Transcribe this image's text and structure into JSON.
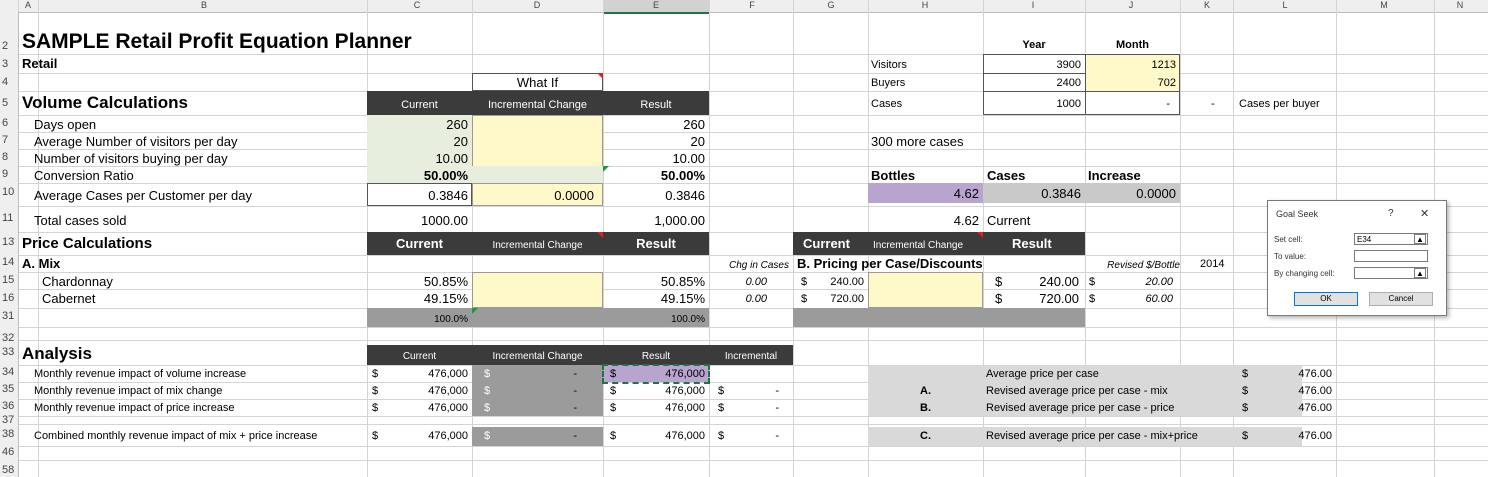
{
  "col_headers": [
    "A",
    "B",
    "C",
    "D",
    "E",
    "F",
    "G",
    "H",
    "I",
    "J",
    "K",
    "L",
    "M",
    "N"
  ],
  "row_numbers": [
    "2",
    "3",
    "4",
    "5",
    "6",
    "7",
    "8",
    "9",
    "10",
    "11",
    "13",
    "14",
    "15",
    "16",
    "31",
    "32",
    "33",
    "34",
    "35",
    "36",
    "37",
    "38",
    "46",
    "58"
  ],
  "title": "SAMPLE Retail Profit Equation Planner",
  "subtitle": "Retail",
  "what_if": "What If",
  "volume": {
    "heading": "Volume Calculations",
    "hdr_current": "Current",
    "hdr_incr": "Incremental Change",
    "hdr_result": "Result",
    "rows": [
      {
        "label": "Days open",
        "current": "260",
        "incr": "",
        "result": "260"
      },
      {
        "label": "Average Number of visitors per day",
        "current": "20",
        "incr": "",
        "result": "20"
      },
      {
        "label": "Number of visitors buying per day",
        "current": "10.00",
        "incr": "",
        "result": "10.00"
      },
      {
        "label": "Conversion Ratio",
        "current": "50.00%",
        "incr": "",
        "result": "50.00%"
      },
      {
        "label": "Average Cases per Customer per day",
        "current": "0.3846",
        "incr": "0.0000",
        "result": "0.3846"
      }
    ],
    "total_label": "Total cases sold",
    "total_current": "1000.00",
    "total_result": "1,000.00"
  },
  "price": {
    "heading": "Price Calculations",
    "hdr_current": "Current",
    "hdr_incr": "Incremental Change",
    "hdr_result": "Result",
    "mix_label": "A. Mix",
    "chg_in_cases": "Chg in Cases",
    "rows": [
      {
        "label": "Chardonnay",
        "current": "50.85%",
        "result": "50.85%",
        "chg": "0.00"
      },
      {
        "label": "Cabernet",
        "current": "49.15%",
        "result": "49.15%",
        "chg": "0.00"
      }
    ],
    "total_current": "100.0%",
    "total_result": "100.0%"
  },
  "pricing_case": {
    "hdr_current": "Current",
    "hdr_incr": "Incremental Change",
    "hdr_result": "Result",
    "title": "B. Pricing per Case/Discounts",
    "revised_hdr": "Revised $/Bottle",
    "year": "2014",
    "rows": [
      {
        "cur_sym": "$",
        "cur": "240.00",
        "res_sym": "$",
        "res": "240.00",
        "rev_sym": "$",
        "rev": "20.00"
      },
      {
        "cur_sym": "$",
        "cur": "720.00",
        "res_sym": "$",
        "res": "720.00",
        "rev_sym": "$",
        "rev": "60.00"
      }
    ]
  },
  "top_right": {
    "year_hdr": "Year",
    "month_hdr": "Month",
    "rows": [
      {
        "label": "Visitors",
        "year": "3900",
        "month": "1213"
      },
      {
        "label": "Buyers",
        "year": "2400",
        "month": "702"
      },
      {
        "label": "Cases",
        "year": "1000",
        "month": "-"
      }
    ],
    "dash": "-",
    "cases_per_buyer": "Cases per buyer",
    "more_cases": "300 more cases",
    "bottles_hdr": "Bottles",
    "cases_hdr": "Cases",
    "increase_hdr": "Increase",
    "bottles_val": "4.62",
    "cases_val": "0.3846",
    "increase_val": "0.0000",
    "bottles_current": "4.62",
    "current_label": "Current"
  },
  "analysis": {
    "heading": "Analysis",
    "hdr_current": "Current",
    "hdr_incr": "Incremental Change",
    "hdr_result": "Result",
    "hdr_incremental": "Incremental",
    "rows": [
      {
        "label": "Monthly revenue impact of volume increase",
        "cur_sym": "$",
        "cur": "476,000",
        "inc_sym": "$",
        "inc": "-",
        "res_sym": "$",
        "res": "476,000",
        "i_sym": "",
        "i": ""
      },
      {
        "label": "Monthly revenue impact of mix change",
        "cur_sym": "$",
        "cur": "476,000",
        "inc_sym": "$",
        "inc": "-",
        "res_sym": "$",
        "res": "476,000",
        "i_sym": "$",
        "i": "-"
      },
      {
        "label": "Monthly revenue impact of price increase",
        "cur_sym": "$",
        "cur": "476,000",
        "inc_sym": "$",
        "inc": "-",
        "res_sym": "$",
        "res": "476,000",
        "i_sym": "$",
        "i": "-"
      },
      {
        "label": "Combined monthly revenue impact of mix + price increase",
        "cur_sym": "$",
        "cur": "476,000",
        "inc_sym": "$",
        "inc": "-",
        "res_sym": "$",
        "res": "476,000",
        "i_sym": "$",
        "i": "-"
      }
    ],
    "side": [
      {
        "key": "",
        "label": "Average price per case",
        "sym": "$",
        "val": "476.00"
      },
      {
        "key": "A.",
        "label": "Revised average price per case - mix",
        "sym": "$",
        "val": "476.00"
      },
      {
        "key": "B.",
        "label": "Revised average price per case - price",
        "sym": "$",
        "val": "476.00"
      },
      {
        "key": "C.",
        "label": "Revised average price per case - mix+price",
        "sym": "$",
        "val": "476.00"
      }
    ]
  },
  "goal_seek": {
    "title": "Goal Seek",
    "help": "?",
    "close": "✕",
    "set_cell_label": "Set cell:",
    "set_cell_value": "E34",
    "to_value_label": "To value:",
    "to_value_value": "",
    "changing_label": "By changing cell:",
    "changing_value": "",
    "ok": "OK",
    "cancel": "Cancel"
  }
}
